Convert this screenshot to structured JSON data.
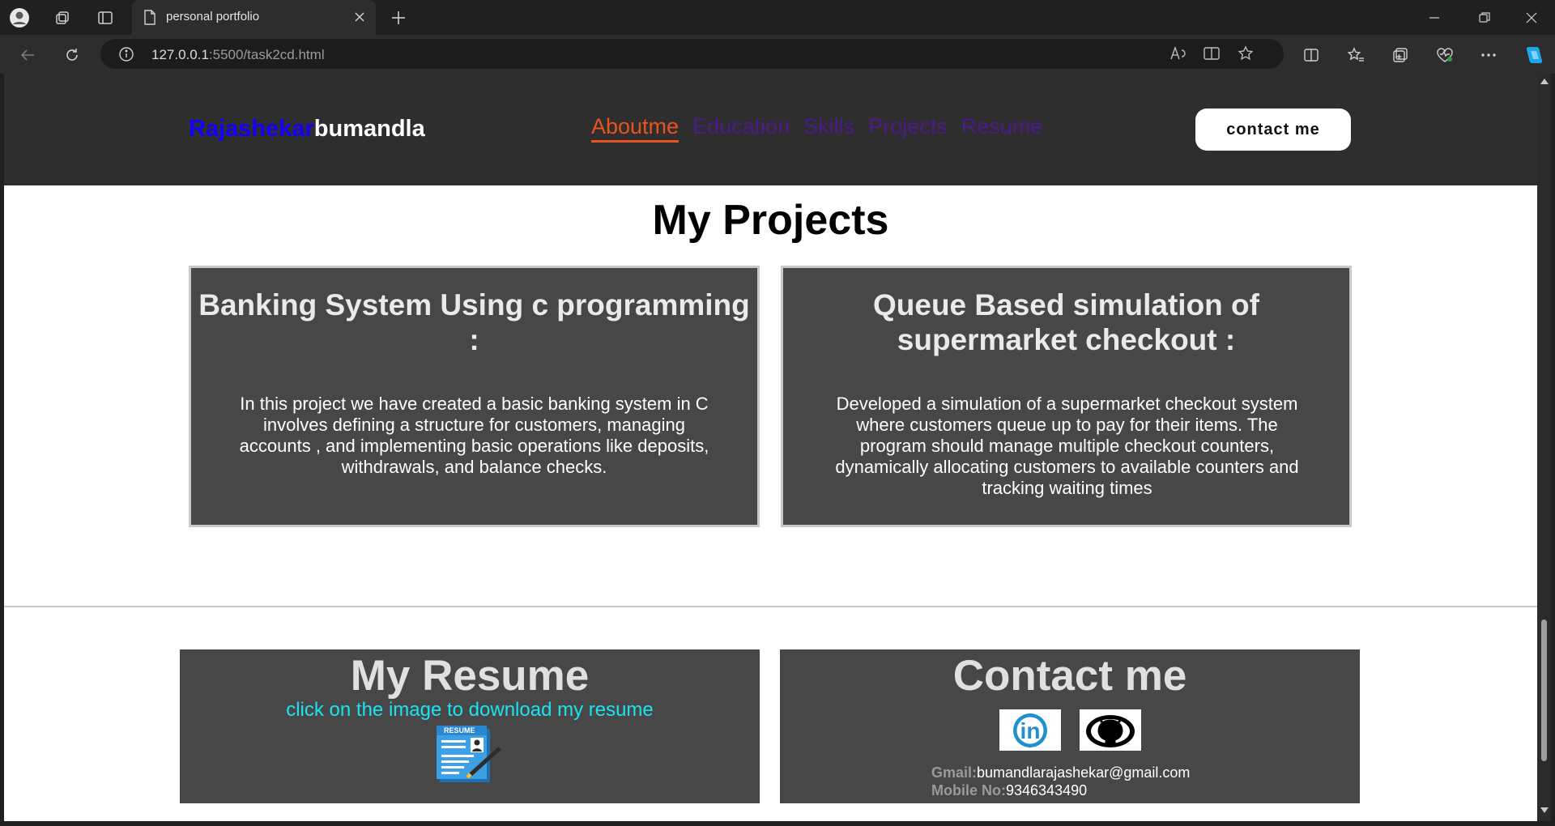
{
  "browser": {
    "tab_title": "personal portfolio",
    "url_host": "127.0.0.1",
    "url_rest": ":5500/task2cd.html"
  },
  "site": {
    "logo_first": "Rajashekar",
    "logo_last": "bumandla",
    "nav": [
      {
        "label": "Aboutme",
        "active": true
      },
      {
        "label": "Education"
      },
      {
        "label": "Skills"
      },
      {
        "label": "Projects"
      },
      {
        "label": "Resume"
      }
    ],
    "contact_button": "contact me"
  },
  "projects": {
    "title": "My Projects",
    "items": [
      {
        "title": "Banking System Using c programming :",
        "desc": "In this project we have created a basic banking system in C involves defining a structure for customers, managing accounts , and implementing basic operations like deposits, withdrawals, and balance checks."
      },
      {
        "title": "Queue Based simulation of supermarket checkout :",
        "desc": "Developed a simulation of a supermarket checkout system where customers queue up to pay for their items. The program should manage multiple checkout counters, dynamically allocating customers to available counters and tracking waiting times"
      }
    ]
  },
  "resume": {
    "title": "My Resume",
    "link_text": "click on the image to download my resume",
    "image_label": "RESUME"
  },
  "contact": {
    "title": "Contact me",
    "gmail_label": "Gmail:",
    "gmail_value": "bumandlarajashekar@gmail.com",
    "mobile_label": "Mobile No:",
    "mobile_value": "9346343490",
    "linkedin_text": "in"
  },
  "colors": {
    "logo_first": "#1400ff",
    "nav_active": "#e8531e",
    "nav_link": "#4b1a8c",
    "resume_link": "#19e5f0",
    "card_bg": "#474747"
  }
}
